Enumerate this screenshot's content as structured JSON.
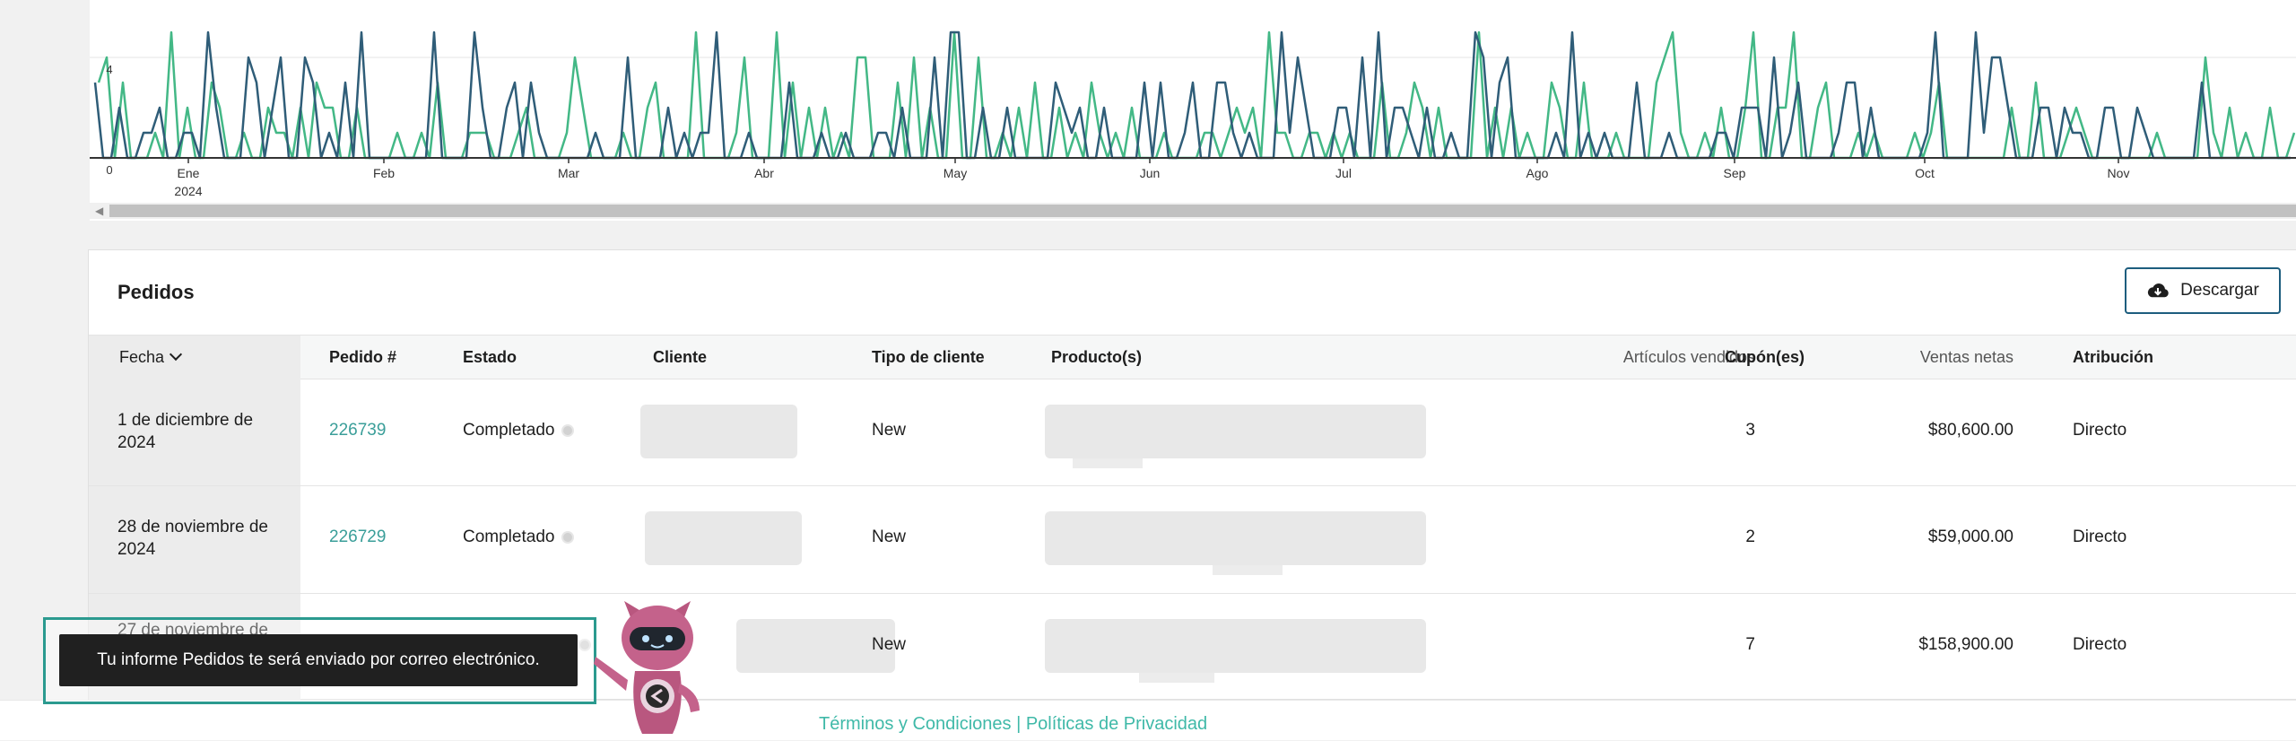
{
  "chart": {
    "y_ticks": [
      "0",
      "4"
    ],
    "x_months": [
      "Ene",
      "Feb",
      "Mar",
      "Abr",
      "May",
      "Jun",
      "Jul",
      "Ago",
      "Sep",
      "Oct",
      "Nov"
    ],
    "x_year": "2024",
    "colors": {
      "series_dark": "#2f5d78",
      "series_green": "#43b886",
      "axis": "#333333",
      "grid": "#e6e6e6"
    }
  },
  "orders": {
    "title": "Pedidos",
    "download_label": "Descargar",
    "columns": {
      "date": "Fecha",
      "order": "Pedido #",
      "status": "Estado",
      "customer": "Cliente",
      "customer_type": "Tipo de cliente",
      "products": "Producto(s)",
      "items_sold": "Artículos vendidos",
      "coupons": "Cupón(es)",
      "net_sales": "Ventas netas",
      "attribution": "Atribución"
    },
    "rows": [
      {
        "date": "1 de diciembre de 2024",
        "order": "226739",
        "status": "Completado",
        "customer_type": "New",
        "items_sold": "3",
        "net_sales": "$80,600.00",
        "attribution": "Directo"
      },
      {
        "date": "28 de noviembre de 2024",
        "order": "226729",
        "status": "Completado",
        "customer_type": "New",
        "items_sold": "2",
        "net_sales": "$59,000.00",
        "attribution": "Directo"
      },
      {
        "date": "27 de noviembre de 2024",
        "order": "",
        "status": "",
        "customer_type": "New",
        "items_sold": "7",
        "net_sales": "$158,900.00",
        "attribution": "Directo"
      }
    ]
  },
  "toast": {
    "message": "Tu informe Pedidos te será enviado por correo electrónico."
  },
  "footer": {
    "links": "Términos y Condiciones | Políticas de Privacidad"
  }
}
